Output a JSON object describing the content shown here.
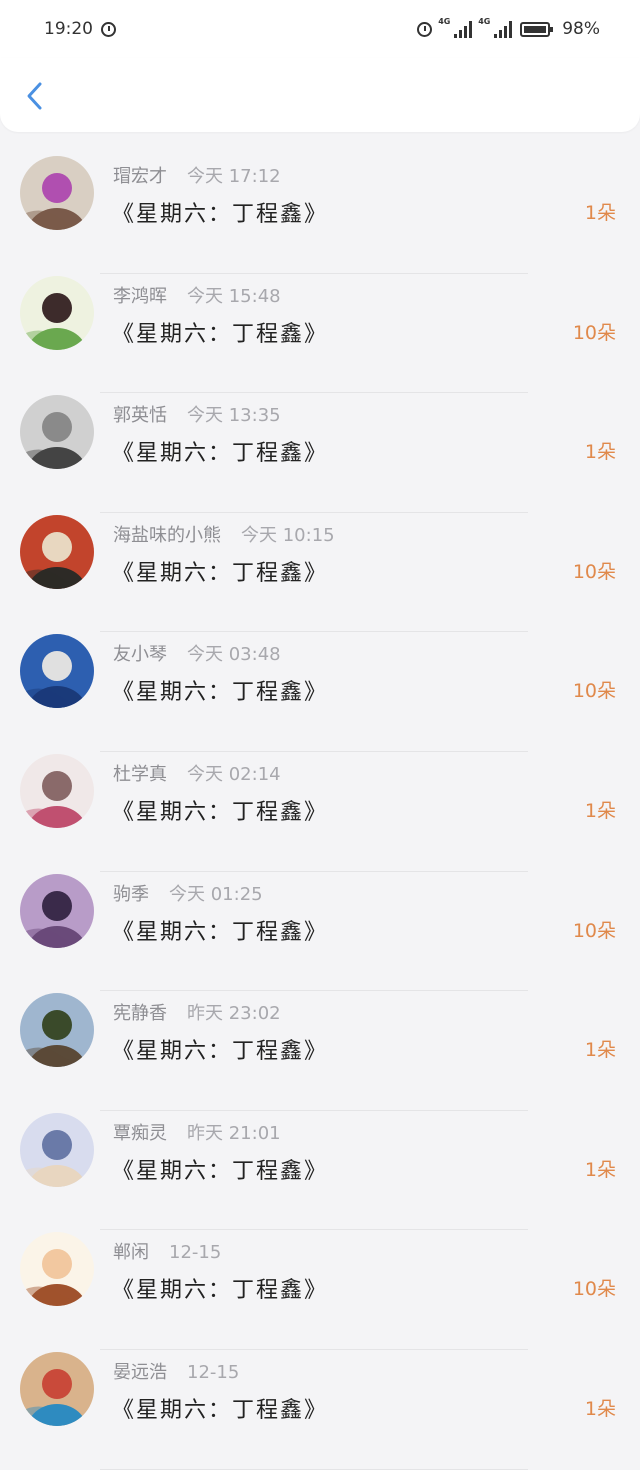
{
  "status_bar": {
    "time": "19:20",
    "network_1": "4G",
    "network_2": "4G",
    "battery": "98%"
  },
  "header": {
    "back_icon": "chevron-left-icon"
  },
  "colors": {
    "accent": "#4a90e2",
    "count": "#e0894b",
    "meta": "#8e8e93",
    "background": "#f4f4f6"
  },
  "items": [
    {
      "name": "瑁宏才",
      "time": "今天 17:12",
      "title": "《星期六：丁程鑫》",
      "count": "1朵"
    },
    {
      "name": "李鸿晖",
      "time": "今天 15:48",
      "title": "《星期六：丁程鑫》",
      "count": "10朵"
    },
    {
      "name": "郭英恬",
      "time": "今天 13:35",
      "title": "《星期六：丁程鑫》",
      "count": "1朵"
    },
    {
      "name": "海盐味的小熊",
      "time": "今天 10:15",
      "title": "《星期六：丁程鑫》",
      "count": "10朵"
    },
    {
      "name": "友小琴",
      "time": "今天 03:48",
      "title": "《星期六：丁程鑫》",
      "count": "10朵"
    },
    {
      "name": "杜学真",
      "time": "今天 02:14",
      "title": "《星期六：丁程鑫》",
      "count": "1朵"
    },
    {
      "name": "驹季",
      "time": "今天 01:25",
      "title": "《星期六：丁程鑫》",
      "count": "10朵"
    },
    {
      "name": "宪静香",
      "time": "昨天 23:02",
      "title": "《星期六：丁程鑫》",
      "count": "1朵"
    },
    {
      "name": "覃痴灵",
      "time": "昨天 21:01",
      "title": "《星期六：丁程鑫》",
      "count": "1朵"
    },
    {
      "name": "郸闲",
      "time": "12-15",
      "title": "《星期六：丁程鑫》",
      "count": "10朵"
    },
    {
      "name": "晏远浩",
      "time": "12-15",
      "title": "《星期六：丁程鑫》",
      "count": "1朵"
    }
  ]
}
